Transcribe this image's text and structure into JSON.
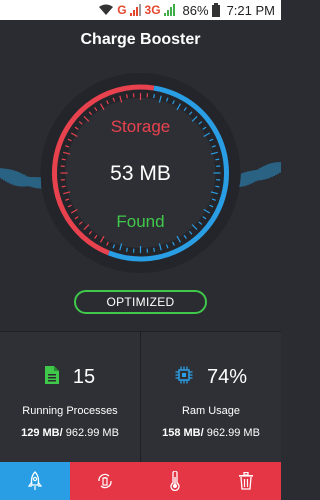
{
  "status_bar": {
    "network_g": "G",
    "network_3g": "3G",
    "battery": "86%",
    "time": "7:21 PM"
  },
  "app": {
    "title": "Charge Booster"
  },
  "gauge": {
    "label_top": "Storage",
    "value": "53 MB",
    "label_bottom": "Found",
    "colors": {
      "red": "#e8424f",
      "blue": "#2a9ee4",
      "wave": "#2a9ee4"
    }
  },
  "actions": {
    "optimize_label": "OPTIMIZED"
  },
  "stats": {
    "processes": {
      "icon": "document-icon",
      "count": "15",
      "label": "Running Processes",
      "used": "129 MB/",
      "total": " 962.99 MB"
    },
    "ram": {
      "icon": "chip-icon",
      "percent": "74%",
      "label": "Ram Usage",
      "used": "158 MB/",
      "total": " 962.99 MB"
    }
  },
  "nav": {
    "items": [
      {
        "icon": "rocket-icon",
        "active": true
      },
      {
        "icon": "battery-cycle-icon",
        "active": false
      },
      {
        "icon": "thermometer-icon",
        "active": false
      },
      {
        "icon": "trash-icon",
        "active": false
      }
    ]
  }
}
